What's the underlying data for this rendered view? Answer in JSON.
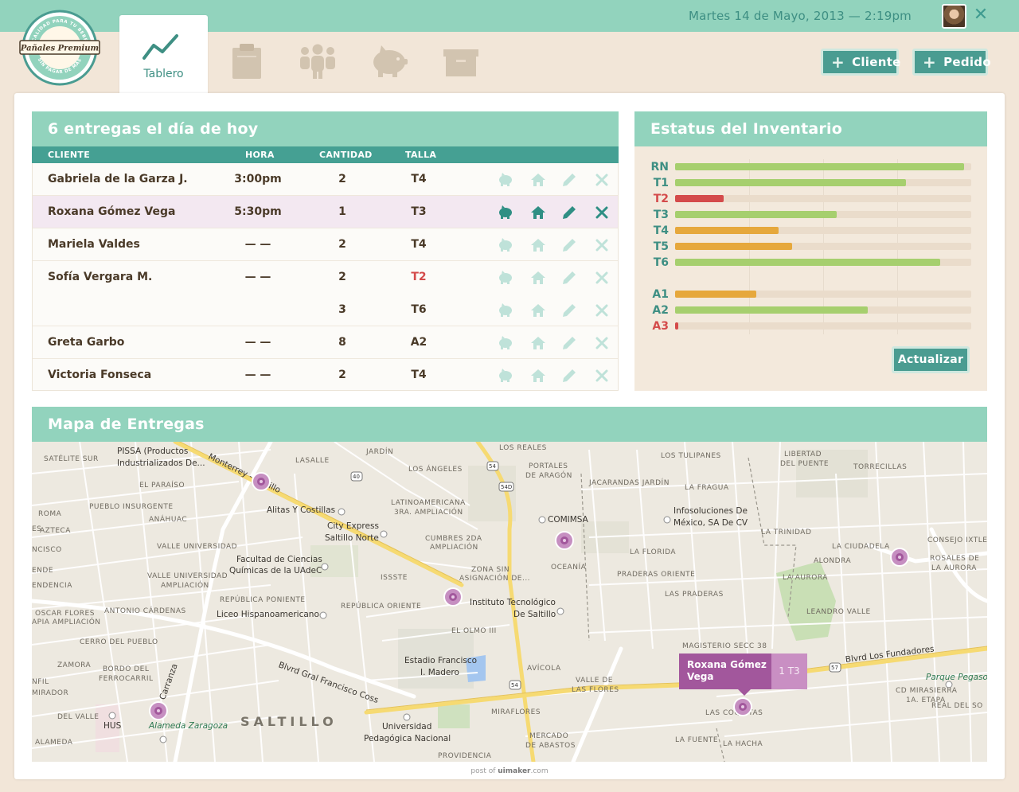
{
  "header": {
    "datetime": "Martes 14 de Mayo, 2013 — 2:19pm",
    "brand": "Pañales Premium",
    "brand_top": "CALIDAD PARA TU BEBÉ",
    "brand_bottom": "SIN PAGAR DE MÁS"
  },
  "nav": {
    "active_tab": "Tablero",
    "icons": [
      "dashboard-icon",
      "clipboard-icon",
      "people-icon",
      "piggy-bank-icon",
      "archive-icon"
    ]
  },
  "actions": {
    "client_label": "Cliente",
    "order_label": "Pedido"
  },
  "deliveries": {
    "title": "6 entregas el día de hoy",
    "columns": [
      "CLIENTE",
      "HORA",
      "CANTIDAD",
      "TALLA"
    ],
    "rows": [
      {
        "client": "Gabriela de la Garza J.",
        "time": "3:00pm",
        "qty": "2",
        "size": "T4"
      },
      {
        "client": "Roxana Gómez Vega",
        "time": "5:30pm",
        "qty": "1",
        "size": "T3"
      },
      {
        "client": "Mariela Valdes",
        "time": "— —",
        "qty": "2",
        "size": "T4"
      },
      {
        "client": "Sofía Vergara M.",
        "time": "— —",
        "qty": "2",
        "size": "T2"
      },
      {
        "client": "",
        "time": "",
        "qty": "3",
        "size": "T6"
      },
      {
        "client": "Greta Garbo",
        "time": "— —",
        "qty": "8",
        "size": "A2"
      },
      {
        "client": "Victoria Fonseca",
        "time": "— —",
        "qty": "2",
        "size": "T4"
      }
    ]
  },
  "inventory": {
    "title": "Estatus del Inventario",
    "update_label": "Actualizar",
    "colors": {
      "ok": "#a6cf6e",
      "mid": "#e6a83c",
      "low": "#d44b4b"
    },
    "items": [
      {
        "label": "RN",
        "level": 0.975,
        "status": "ok"
      },
      {
        "label": "T1",
        "level": 0.78,
        "status": "ok"
      },
      {
        "label": "T2",
        "level": 0.165,
        "status": "low"
      },
      {
        "label": "T3",
        "level": 0.545,
        "status": "ok"
      },
      {
        "label": "T4",
        "level": 0.35,
        "status": "mid"
      },
      {
        "label": "T5",
        "level": 0.395,
        "status": "mid"
      },
      {
        "label": "T6",
        "level": 0.895,
        "status": "ok"
      },
      {
        "label": "A1",
        "level": 0.275,
        "status": "mid"
      },
      {
        "label": "A2",
        "level": 0.65,
        "status": "ok"
      },
      {
        "label": "A3",
        "level": 0.01,
        "status": "low"
      }
    ]
  },
  "map": {
    "title": "Mapa de Entregas",
    "popup_name_1": "Roxana Gómez",
    "popup_name_2": "Vega",
    "popup_size": "1 T3",
    "city": "SALTILLO",
    "places": [
      "PISSA (Productos",
      "Industrializados De...",
      "Alitas Y Costillas",
      "City Express",
      "Saltillo Norte",
      "Facultad de Ciencias",
      "Químicas de la UAdeC",
      "Liceo Hispanoamericano",
      "Instituto Tecnológico",
      "De Saltillo",
      "COMIMSA",
      "Infosoluciones De",
      "México, SA De CV",
      "Estadio Francisco",
      "I. Madero",
      "Universidad",
      "Pedagógica Nacional",
      "Alameda Zaragoza",
      "HUS",
      "Parque Pegaso",
      "Blvrd Los Fundadores",
      "Blvrd Gral Francisco Coss",
      "Monterrey - Saltillo",
      "Ilio Carranza"
    ],
    "districts": [
      "SATÉLITE SUR",
      "EL PARAÍSO",
      "PUEBLO INSURGENTE",
      "ROMA",
      "ANÁHUAC",
      "AZTECA",
      "VALLE UNIVERSIDAD",
      "VALLE UNIVERSIDAD",
      "AMPLIACIÓN",
      "REPÚBLICA PONIENTE",
      "REPÚBLICA ORIENTE",
      "ANTONIO CÁRDENAS",
      "OSCAR FLORES",
      "APIA AMPLIACIÓN",
      "CERRO DEL PUEBLO",
      "ZAMORA",
      "BORDO DEL",
      "FERROCARRIL",
      "MIRADOR",
      "DEL VALLE",
      "ALAMEDA",
      "LASALLE",
      "JARDÍN",
      "LOS ÁNGELES",
      "LATINOAMERICANA",
      "3RA. AMPLIACIÓN",
      "CUMBRES 2DA",
      "AMPLIACIÓN",
      "ISSSTE",
      "ZONA SIN",
      "ASIGNACIÓN DE...",
      "LOS REALES",
      "PORTALES",
      "DE ARAGÓN",
      "JACARANDAS JARDÍN",
      "LA FRAGUA",
      "LOS TULIPANES",
      "LIBERTAD",
      "DEL PUENTE",
      "TORRECILLAS",
      "LA TRINIDAD",
      "LA FLORIDA",
      "OCEANÍA",
      "PRADERAS ORIENTE",
      "LAS PRADERAS",
      "LA CIUDADELA",
      "ALONDRA",
      "LA AURORA",
      "LEANDRO VALLE",
      "CONSEJO IXTLERO",
      "ROSALES DE",
      "LA AURORA",
      "EL OLMO III",
      "AVÍCOLA",
      "VALLE DE",
      "LAS FLORES",
      "MIRAFLORES",
      "MERCADO",
      "DE ABASTOS",
      "PROVIDENCIA",
      "LA FUENTE",
      "LA HACHA",
      "LAS COQUITAS",
      "MAGISTERIO SECC 38",
      "CD MIRASIERRA",
      "1A. ETAPA",
      "REAL DEL SO",
      "NCISCO",
      "ENDE",
      "ENDENCIA",
      "ES",
      "NFIL"
    ]
  },
  "footer": {
    "prefix": "post of",
    "site": "uimaker",
    "suffix": ".com"
  }
}
